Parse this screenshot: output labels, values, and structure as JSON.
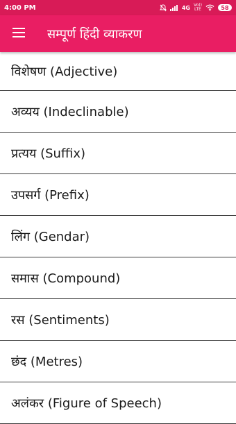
{
  "status_bar": {
    "time": "4:00 PM",
    "network": "4G",
    "volte_top": "Vo))",
    "volte_bottom": "LTE",
    "battery": "58"
  },
  "app_bar": {
    "title": "सम्पूर्ण हिंदी व्याकरण",
    "menu_icon": "hamburger-menu-icon"
  },
  "topics": [
    {
      "label": "विशेषण (Adjective)"
    },
    {
      "label": "अव्यय (Indeclinable)"
    },
    {
      "label": "प्रत्यय (Suffix)"
    },
    {
      "label": "उपसर्ग (Prefix)"
    },
    {
      "label": "लिंग (Gendar)"
    },
    {
      "label": "समास (Compound)"
    },
    {
      "label": "रस (Sentiments)"
    },
    {
      "label": "छंद (Metres)"
    },
    {
      "label": "अलंकर (Figure of Speech)"
    }
  ],
  "colors": {
    "status_bar": "#d81b57",
    "app_bar": "#e91e63",
    "text": "#1a1a1a",
    "divider": "#3a3a3a"
  }
}
